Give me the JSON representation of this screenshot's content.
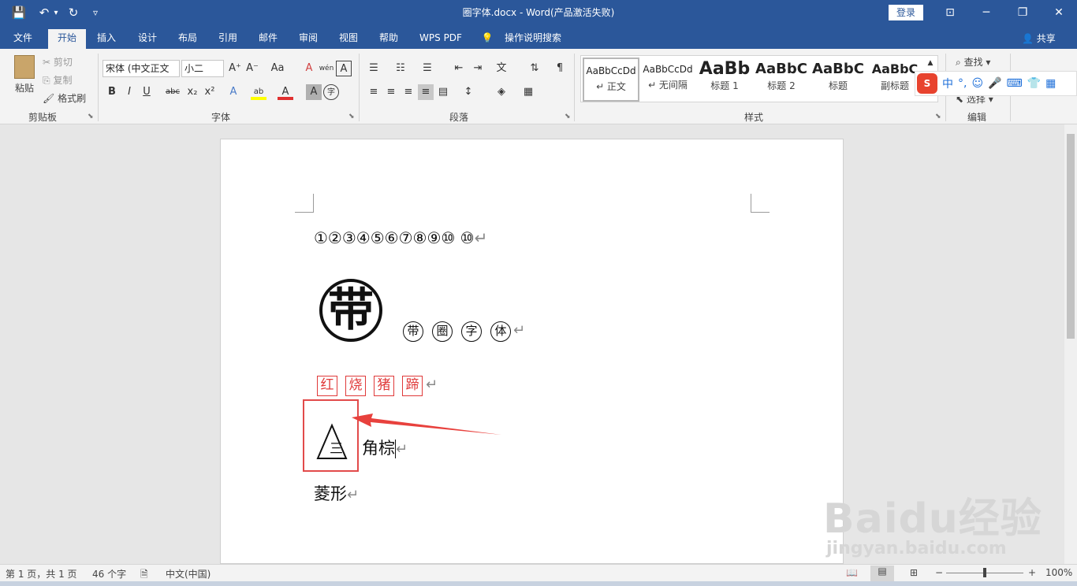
{
  "window": {
    "title": "圈字体.docx  -  Word(产品激活失败)",
    "login_label": "登录",
    "minimize": "─",
    "restore": "❐",
    "close": "✕",
    "ribbon_display": "⊡"
  },
  "quick_access": {
    "save": "💾",
    "undo": "↶",
    "undo_arrow": "▾",
    "redo": "↻",
    "customize": "▿"
  },
  "tabs": [
    "文件",
    "开始",
    "插入",
    "设计",
    "布局",
    "引用",
    "邮件",
    "审阅",
    "视图",
    "帮助",
    "WPS PDF",
    "操作说明搜索"
  ],
  "active_tab": "开始",
  "share_label": "共享",
  "clipboard": {
    "paste": "粘贴",
    "cut": "剪切",
    "copy": "复制",
    "format_painter": "格式刷",
    "group": "剪贴板"
  },
  "font": {
    "name": "宋体 (中文正文",
    "size": "小二",
    "group": "字体",
    "grow": "A⁺",
    "shrink": "A⁻",
    "case": "Aa",
    "clear": "A",
    "phonetic": "wén",
    "charborder": "A",
    "bold": "B",
    "italic": "I",
    "underline": "U",
    "strike": "abc",
    "sub": "x₂",
    "sup": "x²",
    "effects": "A",
    "highlight": "ab",
    "color": "A",
    "shade": "A",
    "enclose": "字"
  },
  "paragraph": {
    "group": "段落"
  },
  "styles": {
    "group": "样式",
    "items": [
      {
        "preview": "AaBbCcDd",
        "name": "↵ 正文"
      },
      {
        "preview": "AaBbCcDd",
        "name": "↵ 无间隔"
      },
      {
        "preview": "AaBb",
        "name": "标题 1"
      },
      {
        "preview": "AaBbC",
        "name": "标题 2"
      },
      {
        "preview": "AaBbC",
        "name": "标题"
      },
      {
        "preview": "AaBbC",
        "name": "副标题"
      }
    ]
  },
  "editing": {
    "find": "查找",
    "select": "选择",
    "group": "编辑"
  },
  "ime": {
    "logo": "S",
    "lang": "中",
    "punct": "°,",
    "emoji": "☺",
    "mic": "🎤",
    "keyboard": "⌨",
    "skin": "👕",
    "tools": "▦"
  },
  "document": {
    "line1": "①②③④⑤⑥⑦⑧⑨⑩ ⑩",
    "big_char": "带",
    "circled_chars": [
      "带",
      "圈",
      "字",
      "体"
    ],
    "boxed_chars": [
      "红",
      "烧",
      "猪",
      "蹄"
    ],
    "triangle_char": "三",
    "triangle_tail": "角棕",
    "line5": "菱形",
    "para_mark": "↵"
  },
  "watermark": {
    "text": "Baidu经验",
    "url": "jingyan.baidu.com"
  },
  "status": {
    "page": "第 1 页，共 1 页",
    "words": "46 个字",
    "language": "中文(中国)",
    "zoom": "100%",
    "minus": "−",
    "plus": "+"
  },
  "colors": {
    "accent": "#2b579a",
    "highlight_box": "#e24a4a",
    "arrow": "#e8413d",
    "boxed_text": "#e03a3a"
  }
}
